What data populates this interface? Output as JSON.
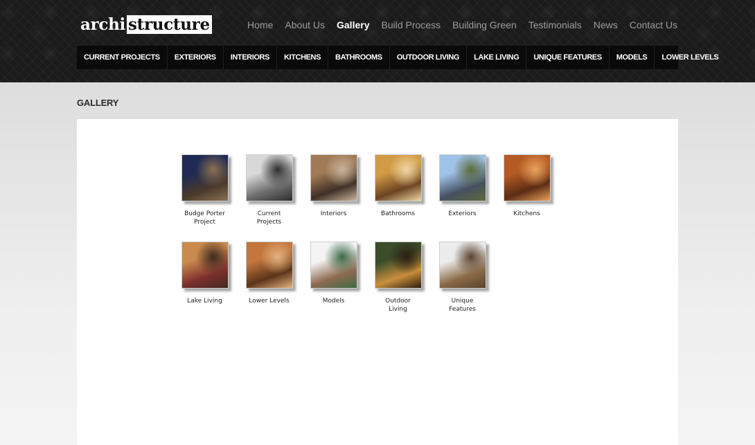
{
  "logo": {
    "part1": "archi",
    "part2": "structure"
  },
  "topnav": [
    {
      "label": "Home",
      "active": false
    },
    {
      "label": "About Us",
      "active": false
    },
    {
      "label": "Gallery",
      "active": true
    },
    {
      "label": "Build Process",
      "active": false
    },
    {
      "label": "Building Green",
      "active": false
    },
    {
      "label": "Testimonials",
      "active": false
    },
    {
      "label": "News",
      "active": false
    },
    {
      "label": "Contact Us",
      "active": false
    }
  ],
  "subnav": [
    "Current Projects",
    "Exteriors",
    "Interiors",
    "Kitchens",
    "Bathrooms",
    "Outdoor Living",
    "Lake Living",
    "Unique Features",
    "Models",
    "Lower Levels"
  ],
  "page_title": "GALLERY",
  "gallery": [
    {
      "label": "Budge Porter\nProject",
      "icon": "photo-budge-porter-icon",
      "colors": [
        "#1f2a55",
        "#4b3a2a",
        "#8a7052"
      ]
    },
    {
      "label": "Current\nProjects",
      "icon": "photo-current-projects-icon",
      "colors": [
        "#d8d8d8",
        "#6d6d6d",
        "#2e2e2e"
      ]
    },
    {
      "label": "Interiors",
      "icon": "photo-interiors-icon",
      "colors": [
        "#a07a55",
        "#3f3027",
        "#c9b49a"
      ]
    },
    {
      "label": "Bathrooms",
      "icon": "photo-bathrooms-icon",
      "colors": [
        "#d19a44",
        "#6b4421",
        "#f0d7a6"
      ]
    },
    {
      "label": "Exteriors",
      "icon": "photo-exteriors-icon",
      "colors": [
        "#9fc2e8",
        "#455060",
        "#5d6b3c"
      ]
    },
    {
      "label": "Kitchens",
      "icon": "photo-kitchens-icon",
      "colors": [
        "#b55a24",
        "#5a2c14",
        "#e9a25d"
      ]
    },
    {
      "label": "Lake Living",
      "icon": "photo-lake-living-icon",
      "colors": [
        "#c98a4d",
        "#7c2e2e",
        "#3e2a1e"
      ]
    },
    {
      "label": "Lower Levels",
      "icon": "photo-lower-levels-icon",
      "colors": [
        "#c4763c",
        "#5b3419",
        "#e2b27e"
      ]
    },
    {
      "label": "Models",
      "icon": "photo-models-icon",
      "colors": [
        "#f3f3f3",
        "#8e6a4f",
        "#3d6b46"
      ]
    },
    {
      "label": "Outdoor\nLiving",
      "icon": "photo-outdoor-living-icon",
      "colors": [
        "#3b4d2a",
        "#c98f3c",
        "#2c1d12"
      ]
    },
    {
      "label": "Unique\nFeatures",
      "icon": "photo-unique-features-icon",
      "colors": [
        "#ececec",
        "#8a6a45",
        "#5a4330"
      ]
    }
  ]
}
